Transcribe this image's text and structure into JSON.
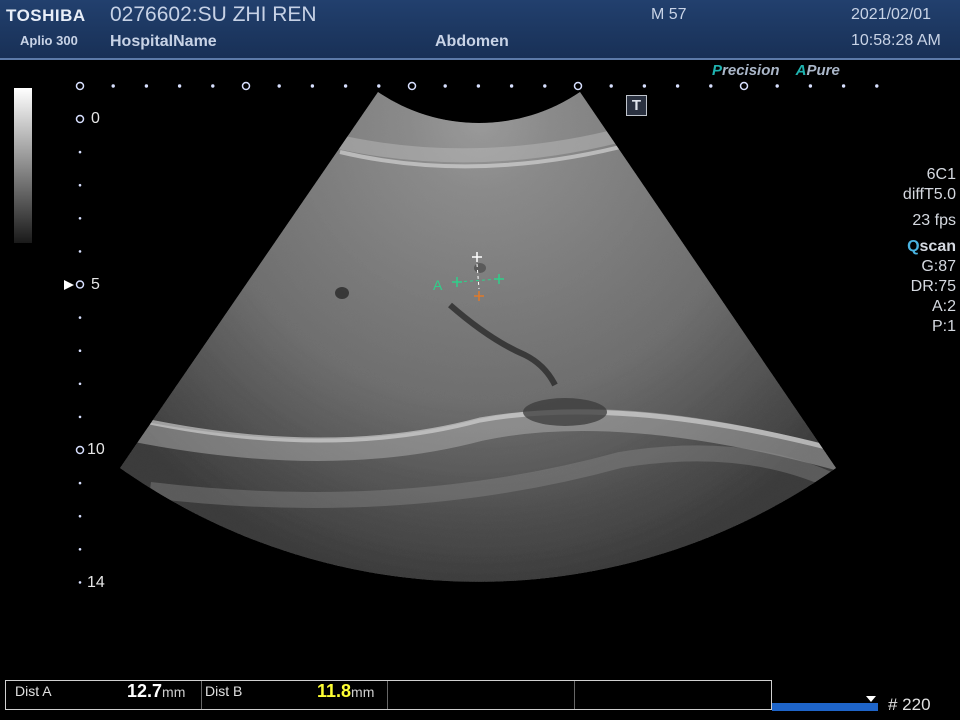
{
  "header": {
    "brand": "TOSHIBA",
    "model": "Aplio 300",
    "patient": "0276602:SU ZHI REN",
    "hospital": "HospitalName",
    "exam": "Abdomen",
    "mi": "M 57",
    "date": "2021/02/01",
    "time": "10:58:28 AM"
  },
  "modes": {
    "precision_cap": "P",
    "precision_rest": "recision",
    "apure_cap": "A",
    "apure_rest": "Pure"
  },
  "marker_t": "T",
  "depth_scale": {
    "labels": [
      "0",
      "5",
      "10",
      "14"
    ]
  },
  "params": {
    "probe": "6C1",
    "freq": "diffT5.0",
    "fps": "23 fps",
    "qscan_cap": "Q",
    "qscan_rest": "scan",
    "gain": "G:87",
    "dr": "DR:75",
    "a": "A:2",
    "p": "P:1"
  },
  "caliper": {
    "label": "A"
  },
  "measurements": [
    {
      "label": "Dist A",
      "value": "12.7",
      "unit": "mm",
      "color": "#ffffff"
    },
    {
      "label": "Dist B",
      "value": "11.8",
      "unit": "mm",
      "color": "#ffff33"
    }
  ],
  "cine": {
    "frame": "# 220"
  },
  "colors": {
    "header_bg": "#1e3a66",
    "caliper_green": "#2fd08a",
    "caliper_orange": "#e07a2a",
    "dist_b": "#ffff33"
  }
}
